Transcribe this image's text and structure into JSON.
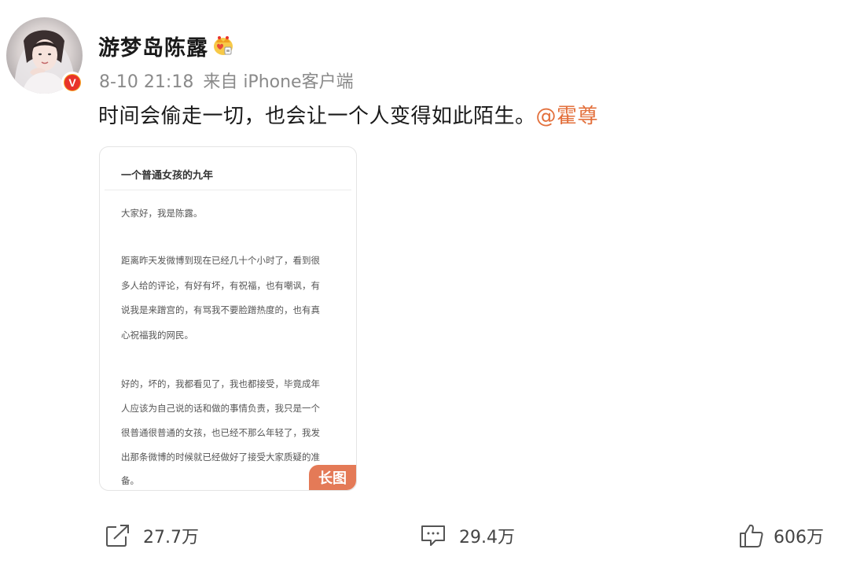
{
  "post": {
    "username": "游梦岛陈露",
    "time": "8-10 21:18",
    "source": "来自 iPhone客户端",
    "text": "时间会偷走一切，也会让一个人变得如此陌生。",
    "mention": "@霍尊",
    "verified_label": "V"
  },
  "image_card": {
    "title": "一个普通女孩的九年",
    "lines": [
      "大家好，我是陈露。",
      "距离昨天发微博到现在已经几十个小时了，看到很",
      "多人给的评论，有好有坏，有祝福，也有嘲讽，有",
      "说我是来蹭宫的，有骂我不要脸蹭热度的，也有真",
      "心祝福我的网民。",
      "好的，坏的，我都看见了，我也都接受，毕竟成年",
      "人应该为自己说的话和做的事情负责，我只是一个",
      "很普通很普通的女孩，也已经不那么年轻了，我发",
      "出那条微博的时候就已经做好了接受大家质疑的准",
      "备。"
    ],
    "badge": "长图"
  },
  "actions": {
    "repost_count": "27.7万",
    "comment_count": "29.4万",
    "like_count": "606万"
  },
  "icons": [
    "avatar",
    "verified-badge-icon",
    "crown-icon",
    "repost-icon",
    "comment-icon",
    "like-icon"
  ],
  "colors": {
    "mention": "#e3703c",
    "badge": "#e47a57",
    "verified_outer": "#f5a623",
    "verified_inner": "#e8332a"
  }
}
